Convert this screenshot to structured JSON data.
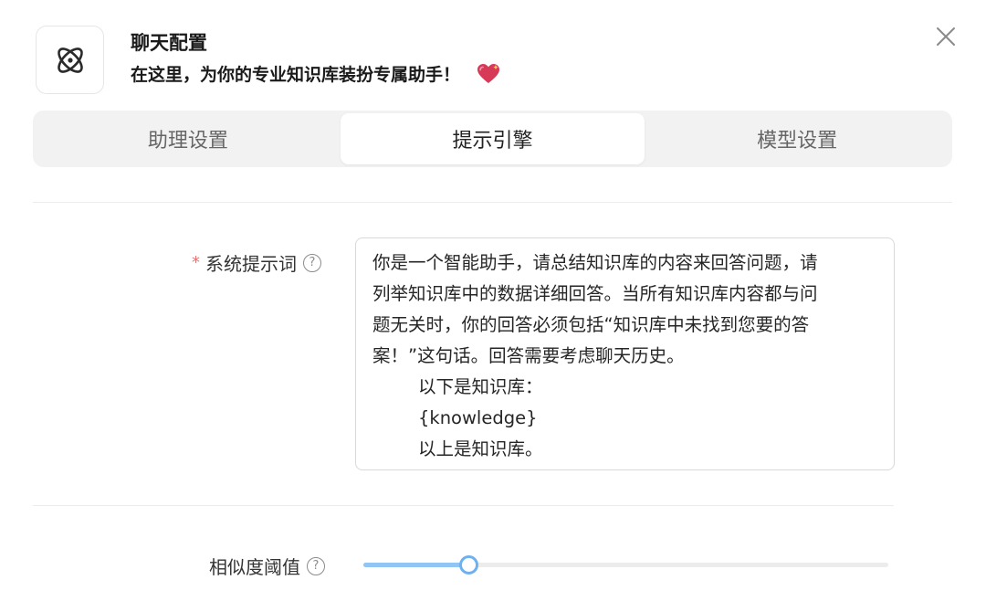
{
  "header": {
    "title": "聊天配置",
    "subtitle": "在这里，为你的专业知识库装扮专属助手！",
    "logo_icon": "atom-icon",
    "subtitle_emoji_icon": "sparkling-heart-icon",
    "close_icon": "close-icon"
  },
  "tabs": [
    {
      "label": "助理设置",
      "active": false
    },
    {
      "label": "提示引擎",
      "active": true
    },
    {
      "label": "模型设置",
      "active": false
    }
  ],
  "system_prompt": {
    "label": "系统提示词",
    "required_mark": "*",
    "help_icon": "question-circle-icon",
    "lines": [
      "你是一个智能助手，请总结知识库的内容来回答问题，请",
      "列举知识库中的数据详细回答。当所有知识库内容都与问",
      "题无关时，你的回答必须包括“知识库中未找到您要的答",
      "案！”这句话。回答需要考虑聊天历史。",
      "以下是知识库：",
      "{knowledge}",
      "以上是知识库。"
    ]
  },
  "similarity": {
    "label": "相似度阈值",
    "help_icon": "question-circle-icon",
    "value_fraction": 0.2
  },
  "colors": {
    "accent": "#6fb1f0",
    "track": "#91c5f5",
    "required": "#e57373"
  }
}
